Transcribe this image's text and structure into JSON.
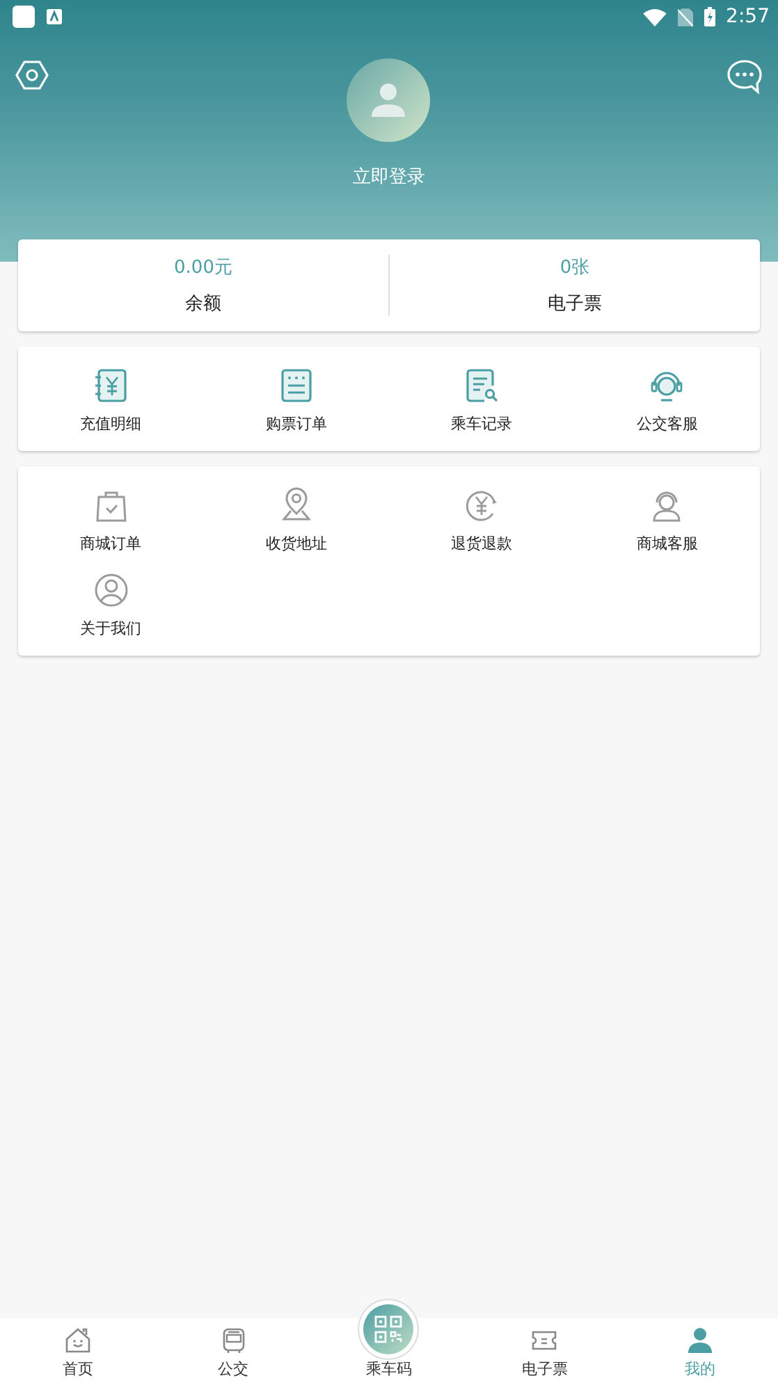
{
  "status_bar": {
    "time": "2:57"
  },
  "profile": {
    "login_label": "立即登录"
  },
  "summary": [
    {
      "value": "0.00元",
      "label": "余额"
    },
    {
      "value": "0张",
      "label": "电子票"
    }
  ],
  "menu_groups": [
    {
      "items": [
        {
          "label": "充值明细"
        },
        {
          "label": "购票订单"
        },
        {
          "label": "乘车记录"
        },
        {
          "label": "公交客服"
        }
      ]
    },
    {
      "items": [
        {
          "label": "商城订单"
        },
        {
          "label": "收货地址"
        },
        {
          "label": "退货退款"
        },
        {
          "label": "商城客服"
        },
        {
          "label": "关于我们"
        }
      ]
    }
  ],
  "tab_bar": [
    {
      "label": "首页",
      "selected": false
    },
    {
      "label": "公交",
      "selected": false
    },
    {
      "label": "乘车码",
      "selected": false
    },
    {
      "label": "电子票",
      "selected": false
    },
    {
      "label": "我的",
      "selected": true
    }
  ]
}
